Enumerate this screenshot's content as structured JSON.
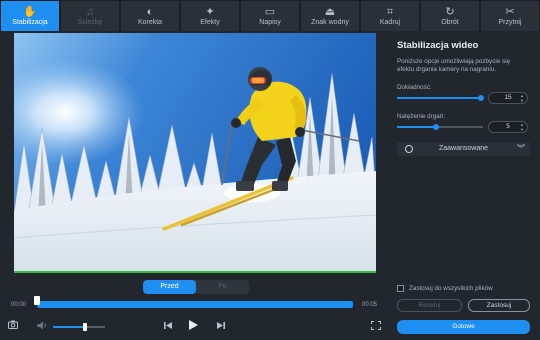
{
  "toolbar": {
    "tabs": [
      {
        "label": "Stabilizacja",
        "icon": "hand-wave-icon",
        "glyph": "✋",
        "state": "active"
      },
      {
        "label": "Ścieżkę",
        "icon": "music-note-icon",
        "glyph": "♫",
        "state": "disabled"
      },
      {
        "label": "Korekta",
        "icon": "contrast-icon",
        "glyph": "◐",
        "state": "normal"
      },
      {
        "label": "Efekty",
        "icon": "magic-wand-icon",
        "glyph": "✦",
        "state": "normal"
      },
      {
        "label": "Napisy",
        "icon": "speech-bubble-icon",
        "glyph": "▭",
        "state": "normal"
      },
      {
        "label": "Znak wodny",
        "icon": "stamp-icon",
        "glyph": "⏏",
        "state": "normal"
      },
      {
        "label": "Kadruj",
        "icon": "crop-icon",
        "glyph": "⌗",
        "state": "normal"
      },
      {
        "label": "Obrót",
        "icon": "rotate-icon",
        "glyph": "↻",
        "state": "normal"
      },
      {
        "label": "Przytnij",
        "icon": "scissors-icon",
        "glyph": "✂",
        "state": "normal"
      }
    ]
  },
  "preview": {
    "toggle": {
      "before": "Przed",
      "after": "Po"
    }
  },
  "timeline": {
    "current_time": "00:00",
    "total_time": "00:05",
    "progress": 0.0
  },
  "volume": {
    "level": 0.6
  },
  "controls": {
    "snapshot_icon": "camera-icon",
    "volume_icon": "speaker-icon",
    "prev_icon": "skip-previous-icon",
    "play_icon": "play-icon",
    "next_icon": "skip-next-icon",
    "fullscreen_icon": "fullscreen-icon"
  },
  "panel": {
    "title": "Stabilizacja wideo",
    "description": "Poniższe opcje umożliwiają pozbycie się efektu drgania kamery na nagraniu.",
    "accuracy": {
      "label": "Dokładność:",
      "value": "15",
      "level": 1.0
    },
    "shake": {
      "label": "Natężenie drgań:",
      "value": "5",
      "level": 0.45
    },
    "advanced": "Zaawansowane",
    "apply_all": "Zastosuj do wszystkich plików",
    "reset": "Resetuj",
    "apply": "Zastosuj",
    "done": "Gotowe"
  },
  "colors": {
    "accent": "#1f8ef1",
    "background": "#22272e",
    "video_border": "#3bb83f"
  }
}
